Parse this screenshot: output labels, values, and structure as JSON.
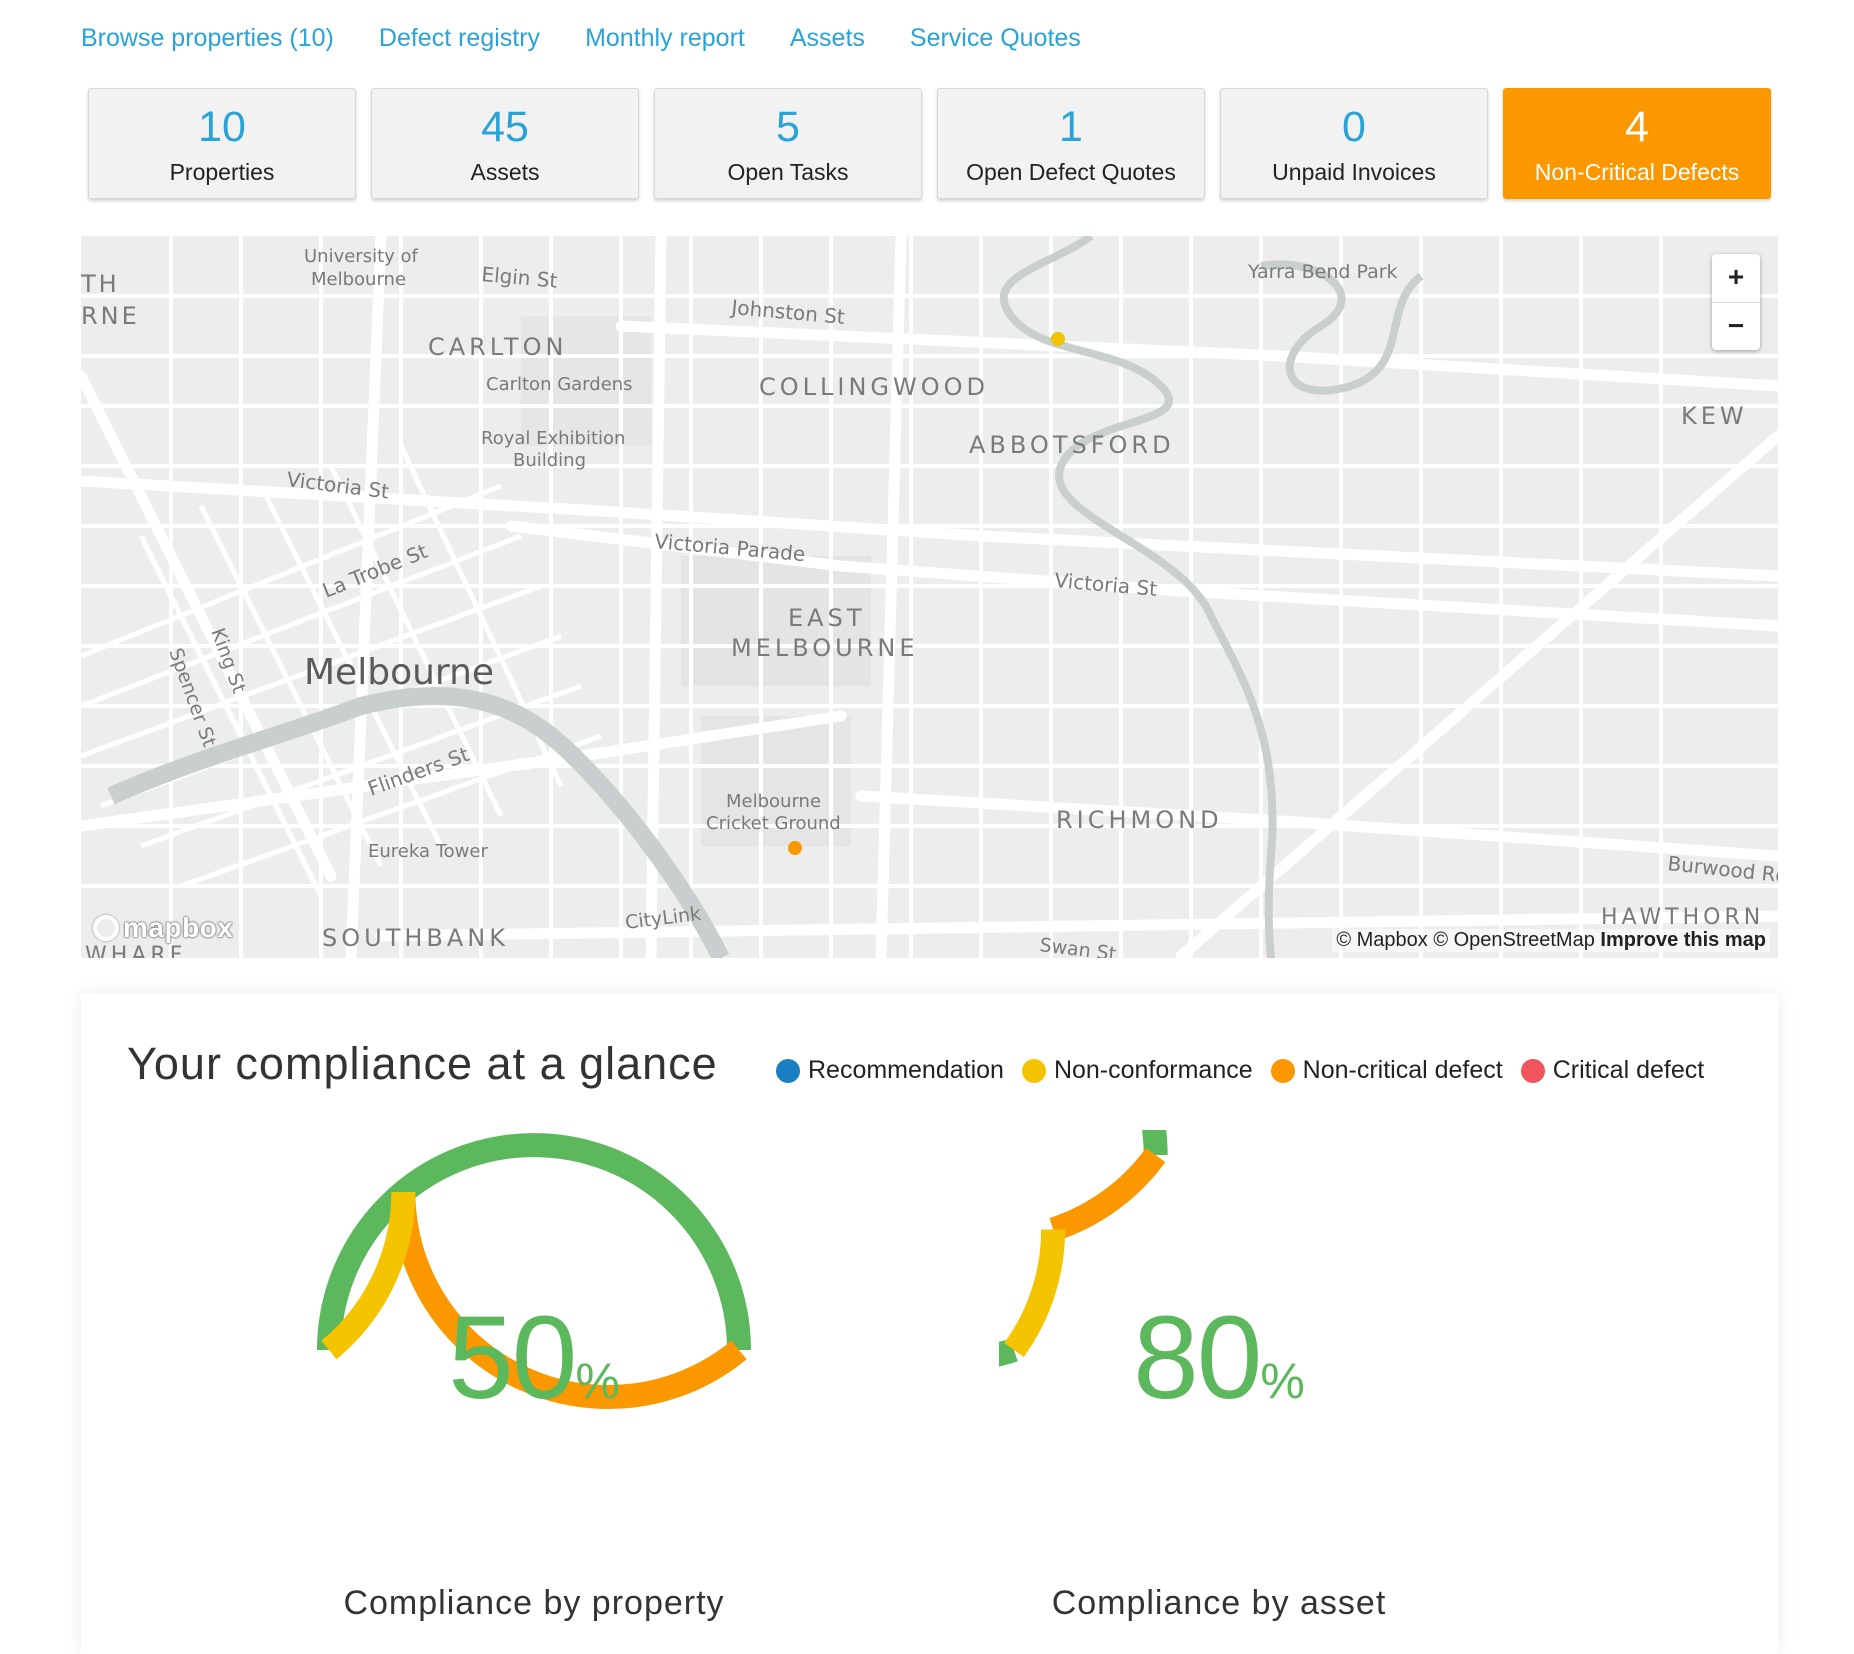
{
  "nav": {
    "links": [
      "Browse properties (10)",
      "Defect registry",
      "Monthly report",
      "Assets",
      "Service Quotes"
    ]
  },
  "stats": [
    {
      "value": "10",
      "label": "Properties"
    },
    {
      "value": "45",
      "label": "Assets"
    },
    {
      "value": "5",
      "label": "Open Tasks"
    },
    {
      "value": "1",
      "label": "Open Defect Quotes"
    },
    {
      "value": "0",
      "label": "Unpaid Invoices"
    },
    {
      "value": "4",
      "label": "Non-Critical Defects",
      "highlight_color": "#fb9800"
    }
  ],
  "map": {
    "labels": {
      "university": [
        "University of",
        "Melbourne"
      ],
      "elgin": "Elgin St",
      "johnston": "Johnston St",
      "yarra_bend": "Yarra Bend Park",
      "carlton": "CARLTON",
      "carlton_gardens": "Carlton Gardens",
      "royal_exhibition": [
        "Royal Exhibition",
        "Building"
      ],
      "collingwood": "COLLINGWOOD",
      "abbotsford": "ABBOTSFORD",
      "kew": "KEW",
      "victoria_st_w": "Victoria St",
      "victoria_parade": "Victoria Parade",
      "victoria_st_e": "Victoria St",
      "la_trobe": "La Trobe St",
      "east_melbourne": [
        "EAST",
        "MELBOURNE"
      ],
      "king": "King St",
      "spencer": "Spencer St",
      "melbourne": "Melbourne",
      "flinders": "Flinders St",
      "mcg": [
        "Melbourne",
        "Cricket Ground"
      ],
      "richmond": "RICHMOND",
      "eureka": "Eureka Tower",
      "burwood": "Burwood Rd",
      "hawthorn": "HAWTHORN",
      "southbank": "SOUTHBANK",
      "citylink": "CityLink",
      "swan": "Swan St",
      "wharf": "WHARF",
      "edge_th": "TH",
      "edge_rne": "RNE"
    },
    "zoom_in": "+",
    "zoom_out": "−",
    "logo": "mapbox",
    "attribution": "© Mapbox © OpenStreetMap",
    "improve": "Improve this map",
    "marker_colors": {
      "non_conformance": "#f2c200",
      "non_critical": "#fb9800"
    }
  },
  "compliance": {
    "title": "Your compliance at a glance",
    "legend": [
      {
        "label": "Recommendation",
        "color": "#1b7fc4"
      },
      {
        "label": "Non-conformance",
        "color": "#f5c400"
      },
      {
        "label": "Non-critical defect",
        "color": "#fb9800"
      },
      {
        "label": "Critical defect",
        "color": "#f0545c"
      }
    ],
    "gauges": [
      {
        "value": "50",
        "unit": "%",
        "label": "Compliance by property",
        "segments": [
          {
            "name": "compliant",
            "fraction": 0.5,
            "color": "#5cb85c"
          },
          {
            "name": "non-critical defect",
            "fraction": 0.36,
            "color": "#fb9800"
          },
          {
            "name": "non-conformance",
            "fraction": 0.14,
            "color": "#f5c400"
          }
        ]
      },
      {
        "value": "80",
        "unit": "%",
        "label": "Compliance by asset",
        "segments": [
          {
            "name": "compliant",
            "fraction": 0.8,
            "color": "#5cb85c"
          },
          {
            "name": "non-critical defect",
            "fraction": 0.1,
            "color": "#fb9800"
          },
          {
            "name": "non-conformance",
            "fraction": 0.1,
            "color": "#f5c400"
          }
        ]
      }
    ]
  }
}
